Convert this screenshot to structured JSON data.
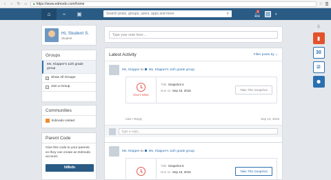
{
  "browser": {
    "url": "https://www.edmodo.com/home"
  },
  "search": {
    "placeholder": "Search posts, groups, users, apps and more"
  },
  "nav": {
    "notification_count": "5"
  },
  "profile": {
    "name": "Hi, Student S.",
    "role": "Student"
  },
  "groups": {
    "title": "Groups",
    "items": [
      {
        "label": "Ms. Klapper's 11th grade group"
      },
      {
        "label": "Show All Groups"
      },
      {
        "label": "Join a Group"
      }
    ]
  },
  "communities": {
    "title": "Communities",
    "items": [
      {
        "label": "Edmodo United"
      }
    ]
  },
  "parent_code": {
    "title": "Parent Code",
    "text": "Give this code to your parents so they can create an Edmodo account:",
    "code": "hl8kdo"
  },
  "post_box": {
    "placeholder": "Type your note here..."
  },
  "feed": {
    "title": "Latest Activity",
    "filter": "Filter posts by ⌄",
    "posts": [
      {
        "author": "Ms. Klapper",
        "to": "to",
        "group": "Ms. Klapper's 11th grade group",
        "badge": "Don't Miss",
        "title_label": "Title:",
        "title": "Snapshot 4",
        "due_label": "Due on:",
        "due": "Sep 10, 2015",
        "button": "Take This Snapshot",
        "like": "Like",
        "reply": "Reply",
        "date": "Sep 10, 2015",
        "reply_placeholder": "Type a reply..."
      },
      {
        "author": "Ms. Klapper",
        "to": "to",
        "group": "Ms. Klapper's 11th grade group",
        "title_label": "Title:",
        "title": "Snapshot 5",
        "due_label": "Due on:",
        "due": "Sep 10, 2015",
        "button": "Take This Snapshot"
      }
    ]
  },
  "apps": {
    "calendar_day": "30"
  },
  "colors": {
    "nav": "#2a5b85",
    "accent": "#2a6fb0",
    "alert": "#e0574a",
    "office": "#e3532b"
  }
}
